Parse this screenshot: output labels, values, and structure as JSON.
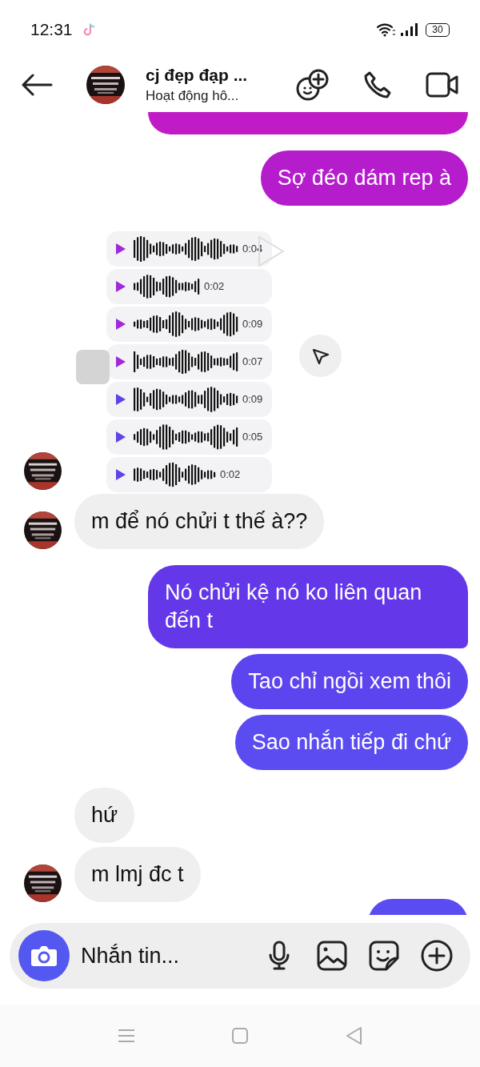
{
  "status_bar": {
    "time": "12:31",
    "battery": "30"
  },
  "header": {
    "name": "cj đẹp đạp ...",
    "status": "Hoạt động hô..."
  },
  "messages": [
    {
      "kind": "sent_partial"
    },
    {
      "kind": "sent",
      "text": "Sợ đéo dám rep à"
    },
    {
      "kind": "voice_screenshot",
      "voice_messages": [
        {
          "duration": "0:04"
        },
        {
          "duration": "0:02"
        },
        {
          "duration": "0:09"
        },
        {
          "duration": "0:07"
        },
        {
          "duration": "0:09"
        },
        {
          "duration": "0:05"
        },
        {
          "duration": "0:02"
        }
      ]
    },
    {
      "kind": "received",
      "text": "m để nó chửi t thế à??",
      "avatar": true
    },
    {
      "kind": "sent",
      "text": "Nó chửi kệ nó ko liên quan đến t"
    },
    {
      "kind": "sent",
      "text": "Tao chỉ ngồi xem thôi"
    },
    {
      "kind": "sent",
      "text": "Sao nhắn tiếp đi chứ"
    },
    {
      "kind": "received",
      "text": "hứ",
      "avatar": false
    },
    {
      "kind": "received",
      "text": "m lmj đc t",
      "avatar": true
    }
  ],
  "composer": {
    "placeholder": "Nhắn tin..."
  }
}
